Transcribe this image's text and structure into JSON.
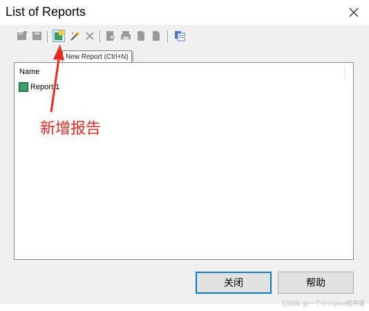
{
  "window": {
    "title": "List of Reports"
  },
  "toolbar": {
    "icons": [
      "open-icon",
      "save-icon",
      "new-report-icon",
      "wizard-icon",
      "delete-icon",
      "preview-icon",
      "print-icon",
      "page-icon",
      "page2-icon",
      "copy-icon"
    ],
    "tooltip": "New Report (Ctrl+N)"
  },
  "list": {
    "column_name": "Name",
    "items": [
      {
        "label": "Report 1"
      }
    ]
  },
  "annotation": {
    "text": "新增报告",
    "color": "#e8291d"
  },
  "buttons": {
    "close_label": "关闭",
    "help_label": "帮助"
  },
  "watermark": "CSDN @一个小小java程序猿"
}
